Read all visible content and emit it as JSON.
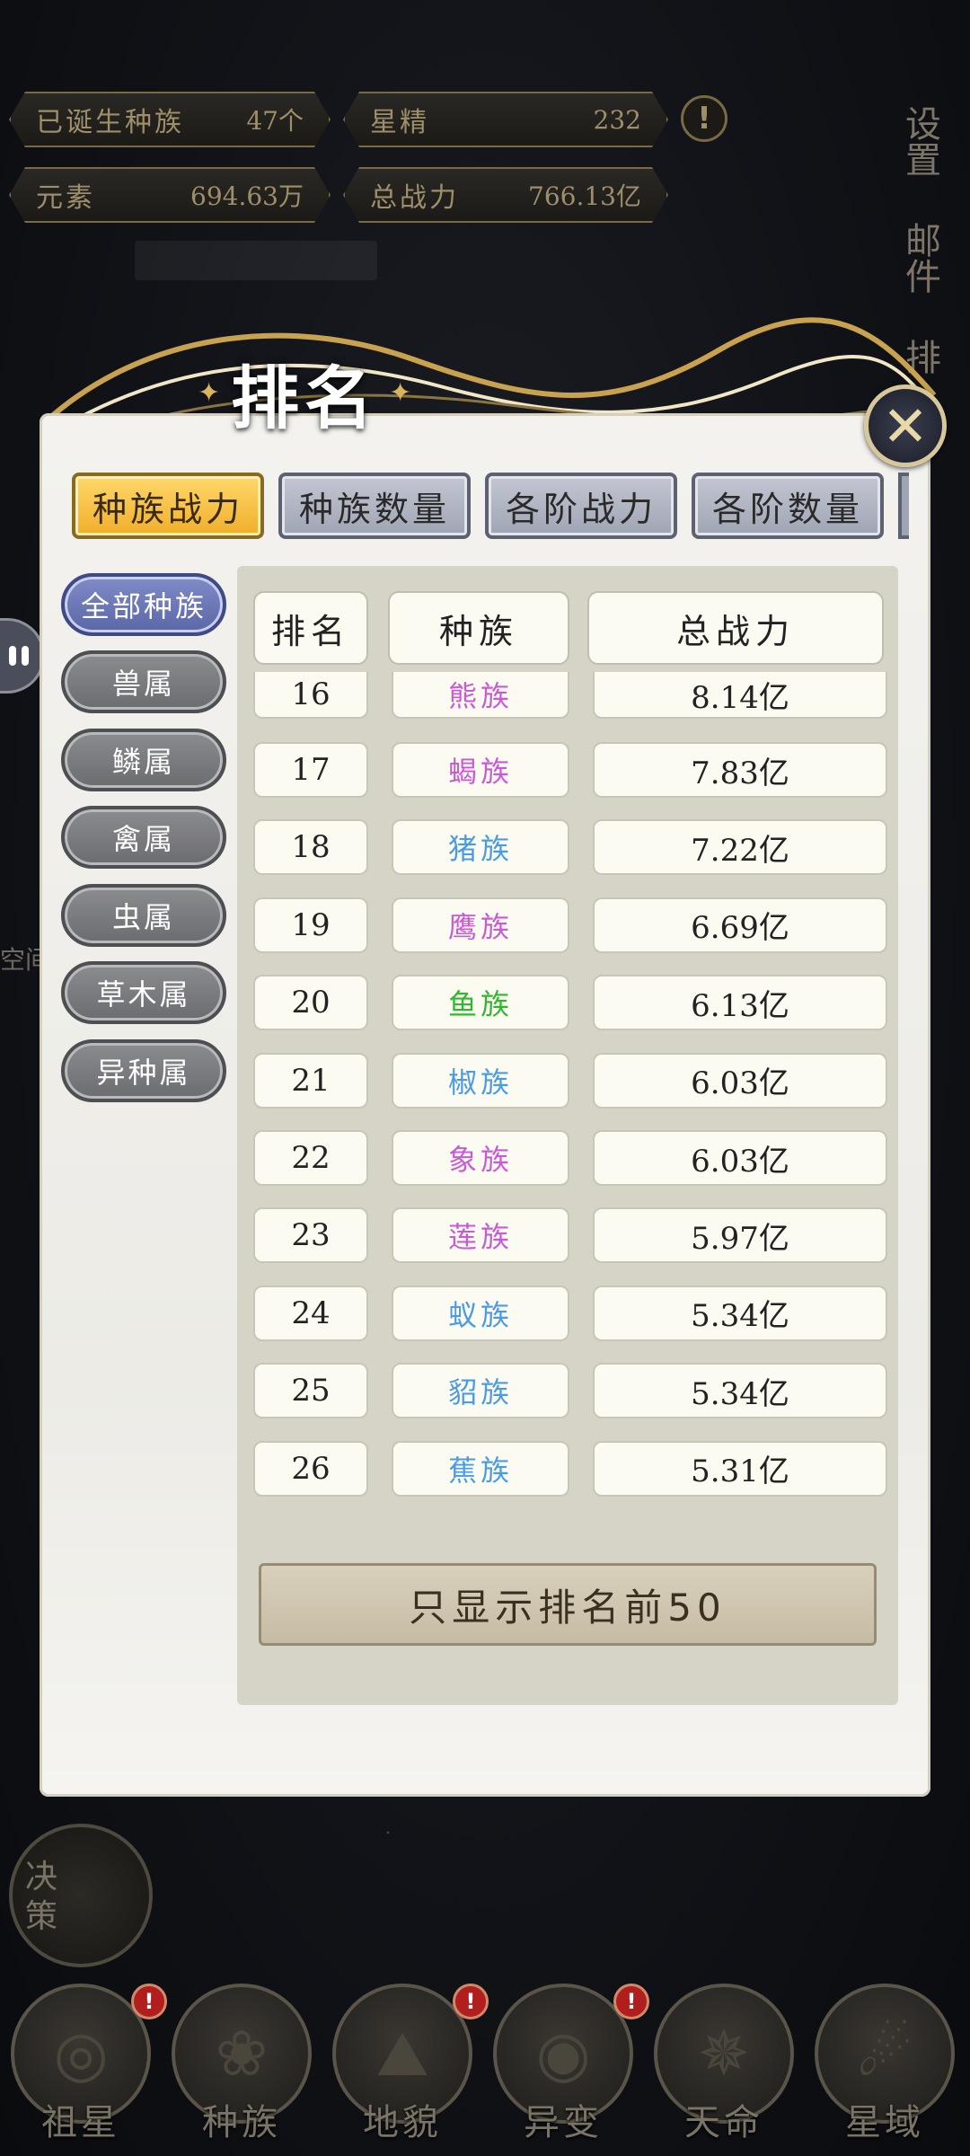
{
  "status": {
    "born_races": {
      "label": "已诞生种族",
      "value": "47个"
    },
    "star_essence": {
      "label": "星精",
      "value": "232"
    },
    "element": {
      "label": "元素",
      "value": "694.63万"
    },
    "total_power": {
      "label": "总战力",
      "value": "766.13亿"
    },
    "alert": "!"
  },
  "side_menu": {
    "settings": "设置",
    "mail": "邮件",
    "rank": "排"
  },
  "modal": {
    "title": "排名",
    "close": "✕",
    "tabs": [
      "种族战力",
      "种族数量",
      "各阶战力",
      "各阶数量"
    ],
    "categories": [
      "全部种族",
      "兽属",
      "鳞属",
      "禽属",
      "虫属",
      "草木属",
      "异种属"
    ],
    "table": {
      "headers": [
        "排名",
        "种族",
        "总战力"
      ],
      "rows": [
        {
          "rank": "16",
          "race": "熊族",
          "power": "8.14亿",
          "color": "#c95ad6"
        },
        {
          "rank": "17",
          "race": "蝎族",
          "power": "7.83亿",
          "color": "#c95ad6"
        },
        {
          "rank": "18",
          "race": "猪族",
          "power": "7.22亿",
          "color": "#4a9be6"
        },
        {
          "rank": "19",
          "race": "鹰族",
          "power": "6.69亿",
          "color": "#c95ad6"
        },
        {
          "rank": "20",
          "race": "鱼族",
          "power": "6.13亿",
          "color": "#2eb82e"
        },
        {
          "rank": "21",
          "race": "椒族",
          "power": "6.03亿",
          "color": "#4a9be6"
        },
        {
          "rank": "22",
          "race": "象族",
          "power": "6.03亿",
          "color": "#c95ad6"
        },
        {
          "rank": "23",
          "race": "莲族",
          "power": "5.97亿",
          "color": "#c95ad6"
        },
        {
          "rank": "24",
          "race": "蚁族",
          "power": "5.34亿",
          "color": "#4a9be6"
        },
        {
          "rank": "25",
          "race": "貂族",
          "power": "5.34亿",
          "color": "#4a9be6"
        },
        {
          "rank": "26",
          "race": "蕉族",
          "power": "5.31亿",
          "color": "#4a9be6"
        }
      ]
    },
    "footer_button": "只显示排名前50"
  },
  "left_dim": {
    "space": "空间",
    "decision": "决策"
  },
  "bottom_nav": [
    {
      "label": "祖星",
      "badge": "!"
    },
    {
      "label": "种族",
      "badge": ""
    },
    {
      "label": "地貌",
      "badge": "!"
    },
    {
      "label": "异变",
      "badge": "!"
    },
    {
      "label": "天命",
      "badge": ""
    },
    {
      "label": "星域",
      "badge": ""
    }
  ]
}
